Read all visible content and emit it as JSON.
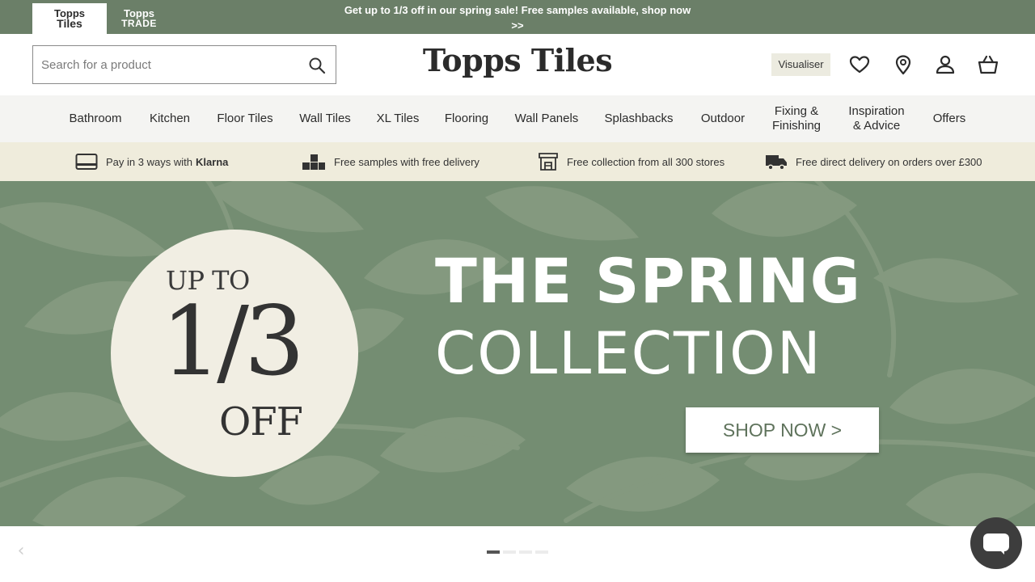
{
  "brands": {
    "tiles": {
      "line1": "Topps",
      "line2": "Tiles"
    },
    "trade": {
      "line1": "Topps",
      "line2": "TRADE"
    }
  },
  "promo": {
    "text": "Get up to 1/3 off in our spring sale! Free samples available, shop now",
    "link": ">>"
  },
  "header": {
    "logo": "Topps Tiles",
    "search_placeholder": "Search for a product",
    "visualiser": "Visualiser",
    "icons": [
      "wishlist-heart-icon",
      "store-locator-pin-icon",
      "account-user-icon",
      "basket-icon"
    ]
  },
  "nav": [
    {
      "label": "Bathroom"
    },
    {
      "label": "Kitchen"
    },
    {
      "label": "Floor Tiles"
    },
    {
      "label": "Wall Tiles"
    },
    {
      "label": "XL Tiles"
    },
    {
      "label": "Flooring"
    },
    {
      "label": "Wall Panels"
    },
    {
      "label": "Splashbacks"
    },
    {
      "label": "Outdoor"
    },
    {
      "label": "Fixing &",
      "label2": "Finishing"
    },
    {
      "label": "Inspiration",
      "label2": "& Advice"
    },
    {
      "label": "Offers"
    }
  ],
  "usp": [
    {
      "text": "Pay in 3 ways with",
      "bold": "Klarna",
      "icon": "card-icon"
    },
    {
      "text": "Free samples with free delivery",
      "icon": "samples-boxes-icon"
    },
    {
      "text": "Free collection from all 300 stores",
      "icon": "store-icon"
    },
    {
      "text": "Free direct delivery on orders over £300",
      "icon": "delivery-truck-icon"
    }
  ],
  "hero": {
    "badge_line1": "UP TO",
    "badge_line2": "1/3",
    "badge_line3": "OFF",
    "title_line1": "THE SPRING",
    "title_line2": "COLLECTION",
    "cta": "SHOP NOW  >"
  },
  "carousel": {
    "slides": 4,
    "active": 1,
    "prev": "‹"
  },
  "colors": {
    "topbar": "#6b7f68",
    "hero": "#748d72",
    "usp_bg": "#efecdc",
    "nav_bg": "#f4f4f2",
    "badge": "#f1eee3"
  }
}
